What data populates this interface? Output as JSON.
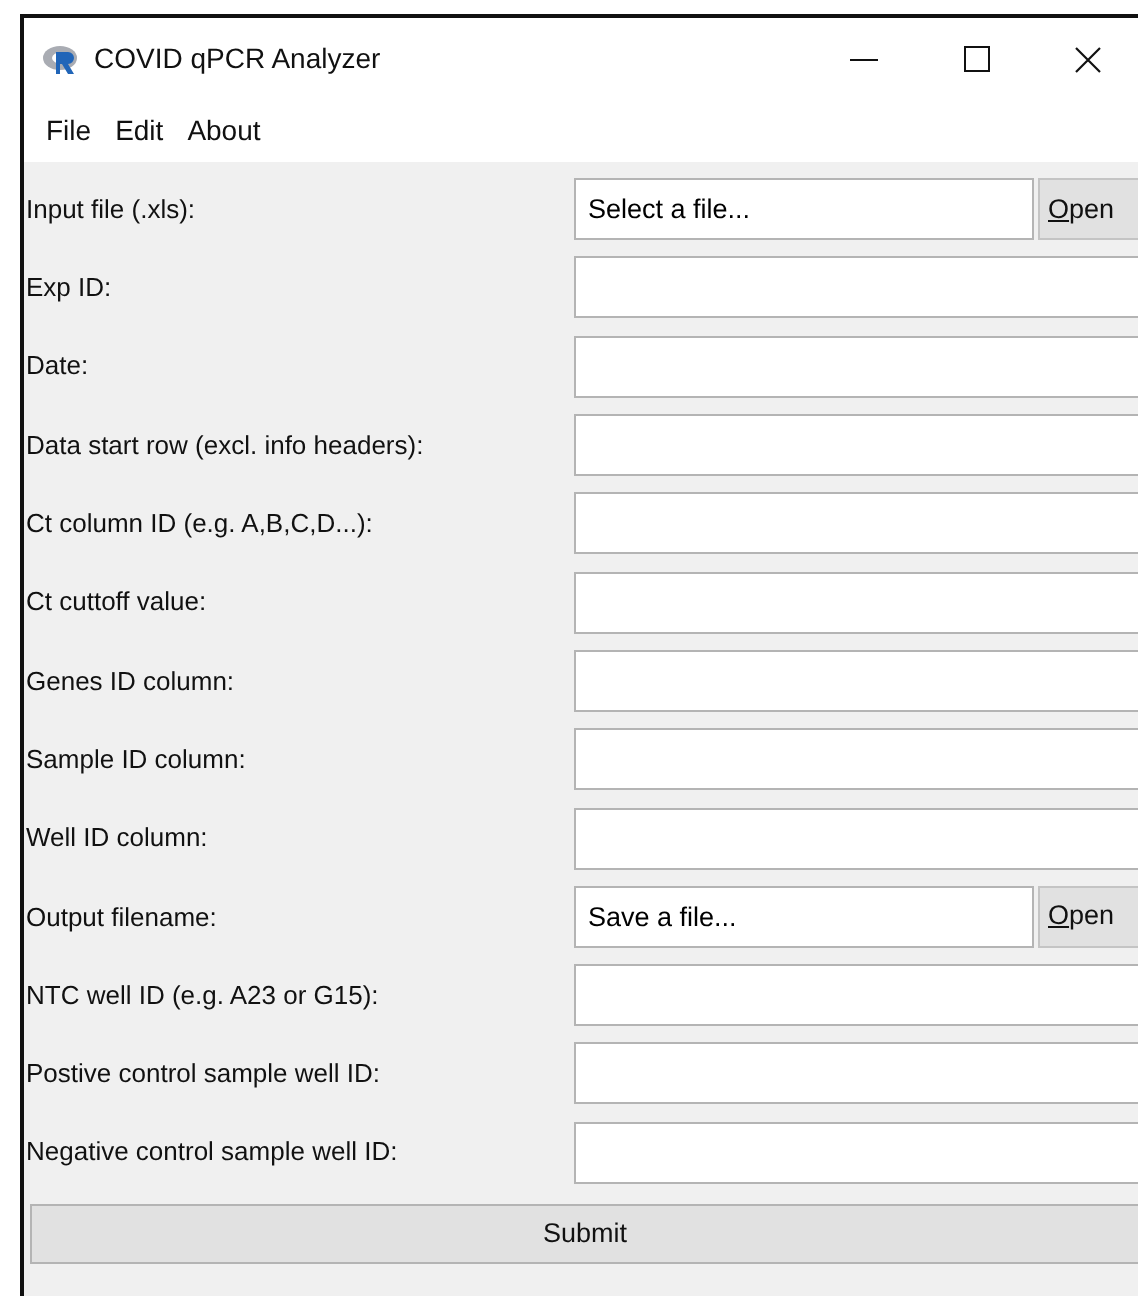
{
  "window": {
    "title": "COVID qPCR Analyzer"
  },
  "menu": [
    "File",
    "Edit",
    "About"
  ],
  "rows": [
    {
      "kind": "file",
      "label": "Input file (.xls):",
      "value": "Select a file...",
      "button": {
        "label": "Open",
        "mnemonic": true
      }
    },
    {
      "kind": "text",
      "label": "Exp ID:"
    },
    {
      "kind": "text",
      "label": "Date:"
    },
    {
      "kind": "text",
      "label": "Data start row (excl. info headers):"
    },
    {
      "kind": "text",
      "label": "Ct column ID (e.g. A,B,C,D...):"
    },
    {
      "kind": "text",
      "label": "Ct cuttoff value:"
    },
    {
      "kind": "text",
      "label": "Genes ID column:"
    },
    {
      "kind": "text",
      "label": "Sample ID column:"
    },
    {
      "kind": "text",
      "label": "Well ID column:"
    },
    {
      "kind": "file",
      "label": "Output filename:",
      "value": "Save a file...",
      "button": {
        "label": "Open",
        "mnemonic": true
      }
    },
    {
      "kind": "text",
      "label": "NTC well ID (e.g. A23 or G15):"
    },
    {
      "kind": "text",
      "label": "Postive control sample well ID:"
    },
    {
      "kind": "text",
      "label": "Negative control sample well ID:"
    }
  ],
  "submit": "Submit"
}
